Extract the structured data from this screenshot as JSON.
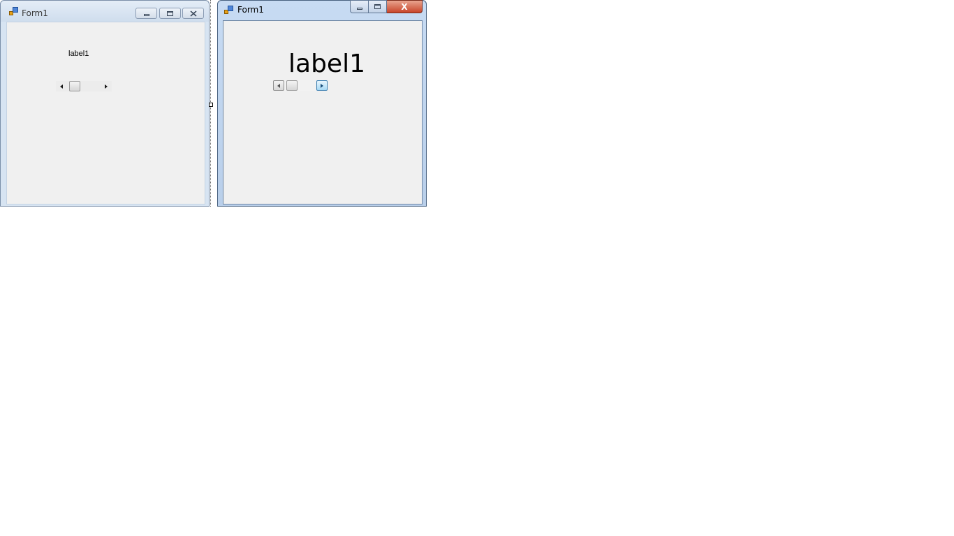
{
  "left_form": {
    "title": "Form1",
    "label_text": "label1",
    "scrollbar": {
      "value_fraction": 0.1
    }
  },
  "right_form": {
    "title": "Form1",
    "label_text": "label1",
    "close_glyph": "X",
    "scrollbar": {
      "value_fraction": 0.1
    }
  },
  "icons": {
    "app": "form-app-icon",
    "minimize": "minimize-icon",
    "maximize": "maximize-icon",
    "close": "close-icon",
    "scroll_left": "triangle-left-icon",
    "scroll_right": "triangle-right-icon"
  },
  "colors": {
    "client_bg": "#f0f0f0",
    "close_button": "#c8452a",
    "active_frame": "#b9cfea",
    "inactive_frame": "#d7e4f2"
  }
}
